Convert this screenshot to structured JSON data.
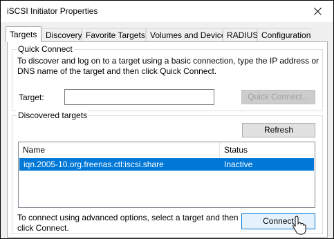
{
  "window": {
    "title": "iSCSI Initiator Properties"
  },
  "tabs": [
    {
      "label": "Targets",
      "active": true
    },
    {
      "label": "Discovery",
      "active": false
    },
    {
      "label": "Favorite Targets",
      "active": false
    },
    {
      "label": "Volumes and Devices",
      "active": false
    },
    {
      "label": "RADIUS",
      "active": false
    },
    {
      "label": "Configuration",
      "active": false
    }
  ],
  "quick_connect": {
    "legend": "Quick Connect",
    "description_line1": "To discover and log on to a target using a basic connection, type the IP address or",
    "description_line2": "DNS name of the target and then click Quick Connect.",
    "target_label": "Target:",
    "target_value": "",
    "button_label": "Quick Connect...",
    "button_enabled": false
  },
  "discovered_targets": {
    "legend": "Discovered targets",
    "refresh_label": "Refresh",
    "columns": [
      "Name",
      "Status"
    ],
    "rows": [
      {
        "name": "iqn.2005-10.org.freenas.ctl:iscsi.share",
        "status": "Inactive",
        "selected": true
      }
    ],
    "connect_hint_line1": "To connect using advanced options, select a target and then",
    "connect_hint_line2": "click Connect.",
    "connect_label": "Connect"
  },
  "colors": {
    "selection": "#0078d7",
    "focus_border": "#0078d7",
    "dialog_bg": "#f0f0f0"
  },
  "icons": [
    "close-icon",
    "mouse-pointer-icon"
  ]
}
